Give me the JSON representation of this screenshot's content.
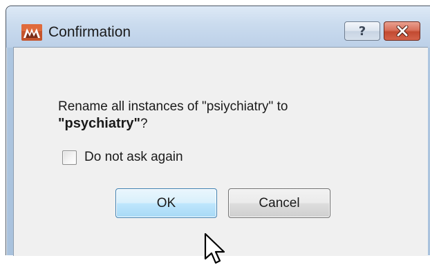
{
  "window": {
    "title": "Confirmation",
    "help_button_glyph": "?",
    "icons": {
      "app": "app-logo-icon",
      "help": "help-icon",
      "close": "close-icon"
    }
  },
  "dialog": {
    "message_line1": "Rename all instances of \"psiychiatry\" to",
    "message_bold": "\"psychiatry\"",
    "message_suffix": "?",
    "checkbox_label": "Do not ask again",
    "checkbox_checked": false,
    "ok_label": "OK",
    "cancel_label": "Cancel"
  },
  "colors": {
    "close_red": "#c24a31",
    "ok_focus_blue": "#3c7fb1",
    "client_bg": "#f0f0f0"
  }
}
